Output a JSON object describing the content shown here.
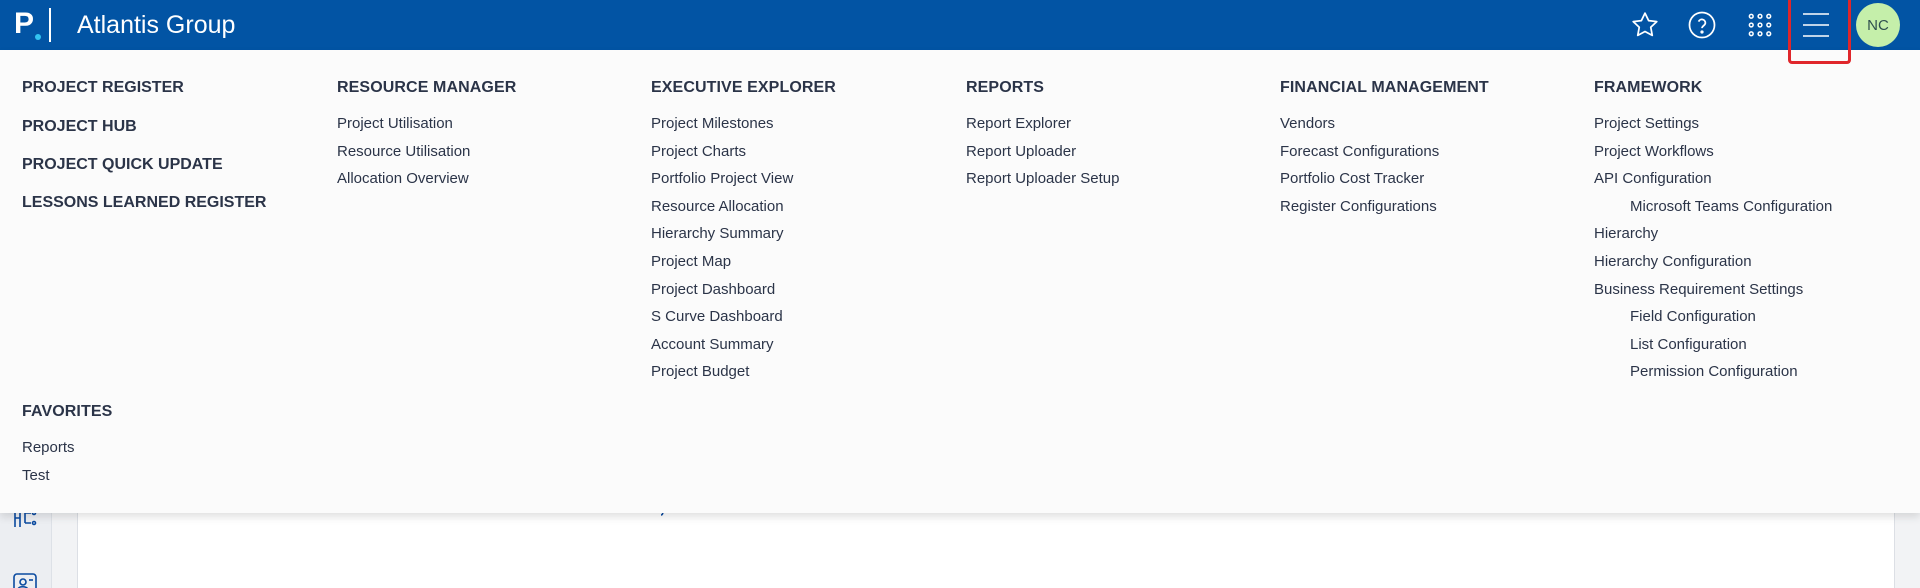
{
  "header": {
    "logo_letter": "P",
    "title": "Atlantis Group",
    "avatar_initials": "NC",
    "icons": [
      "star-icon",
      "help-icon",
      "apps-grid-icon",
      "hamburger-menu-icon"
    ],
    "colors": {
      "bar": "#0254a4",
      "highlight": "#e0262b",
      "avatar": "#c5efaa"
    }
  },
  "menu": {
    "standalone": [
      "PROJECT REGISTER",
      "PROJECT HUB",
      "PROJECT QUICK UPDATE",
      "LESSONS LEARNED REGISTER"
    ],
    "favorites": {
      "title": "FAVORITES",
      "items": [
        "Reports",
        "Test"
      ]
    },
    "columns": [
      {
        "title": "RESOURCE MANAGER",
        "items": [
          "Project Utilisation",
          "Resource Utilisation",
          "Allocation Overview"
        ]
      },
      {
        "title": "EXECUTIVE EXPLORER",
        "items": [
          "Project Milestones",
          "Project Charts",
          "Portfolio Project View",
          "Resource Allocation",
          "Hierarchy Summary",
          "Project Map",
          "Project Dashboard",
          "S Curve Dashboard",
          "Account Summary",
          "Project Budget"
        ]
      },
      {
        "title": "REPORTS",
        "items": [
          "Report Explorer",
          "Report Uploader",
          "Report Uploader Setup"
        ]
      },
      {
        "title": "FINANCIAL MANAGEMENT",
        "items": [
          "Vendors",
          "Forecast Configurations",
          "Portfolio Cost Tracker",
          "Register Configurations"
        ]
      },
      {
        "title": "FRAMEWORK",
        "items": [
          "Project Settings",
          "Project Workflows",
          "API Configuration",
          "Microsoft Teams Configuration",
          "Hierarchy",
          "Hierarchy Configuration",
          "Business Requirement Settings",
          "Field Configuration",
          "List Configuration",
          "Permission Configuration"
        ]
      }
    ]
  }
}
